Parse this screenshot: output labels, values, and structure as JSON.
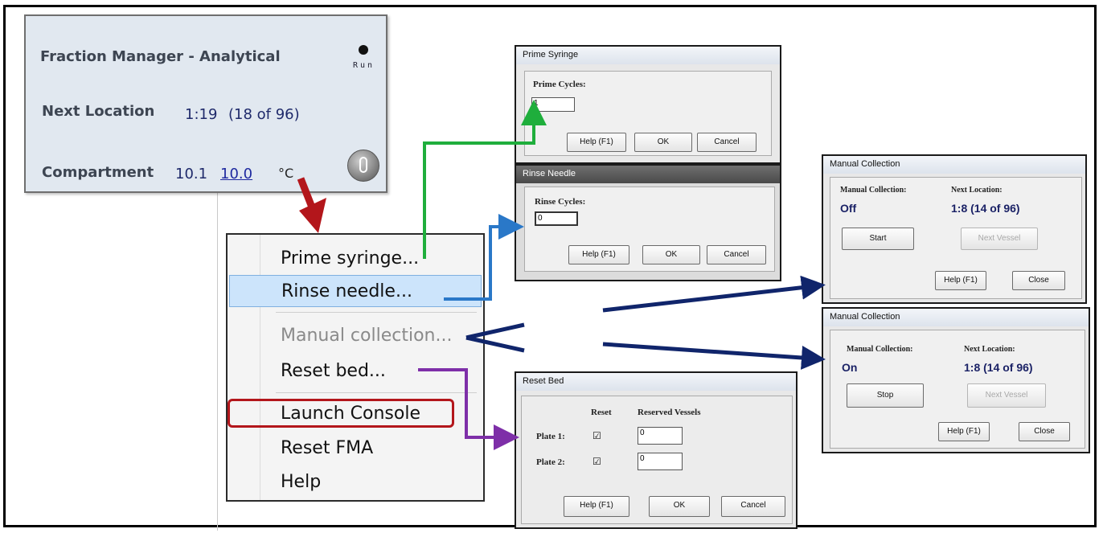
{
  "fraction_manager": {
    "title": "Fraction Manager - Analytical",
    "status": "Run",
    "next_location_label": "Next Location",
    "next_location_value": "1:19",
    "next_location_count": "(18 of 96)",
    "compartment_label": "Compartment",
    "compartment_actual": "10.1",
    "compartment_setpoint": "10.0",
    "compartment_unit": "°C"
  },
  "context_menu": {
    "items": [
      {
        "label": "Prime syringe..."
      },
      {
        "label": "Rinse needle..."
      },
      {
        "label": "Manual collection..."
      },
      {
        "label": "Reset bed..."
      },
      {
        "label": "Launch Console"
      },
      {
        "label": "Reset FMA"
      },
      {
        "label": "Help"
      }
    ]
  },
  "prime_syringe_dialog": {
    "title": "Prime Syringe",
    "field_label": "Prime Cycles:",
    "field_value": "1",
    "help": "Help (F1)",
    "ok": "OK",
    "cancel": "Cancel"
  },
  "rinse_needle_dialog": {
    "title": "Rinse Needle",
    "field_label": "Rinse Cycles:",
    "field_value": "0",
    "help": "Help (F1)",
    "ok": "OK",
    "cancel": "Cancel"
  },
  "reset_bed_dialog": {
    "title": "Reset Bed",
    "col_reset": "Reset",
    "col_reserved": "Reserved Vessels",
    "rows": [
      {
        "label": "Plate 1:",
        "checked": "☑",
        "value": "0"
      },
      {
        "label": "Plate 2:",
        "checked": "☑",
        "value": "0"
      }
    ],
    "help": "Help (F1)",
    "ok": "OK",
    "cancel": "Cancel"
  },
  "manual_collection_off": {
    "title": "Manual Collection",
    "mc_label": "Manual Collection:",
    "mc_value": "Off",
    "next_label": "Next Location:",
    "next_value": "1:8  (14 of 96)",
    "start": "Start",
    "next_vessel": "Next Vessel",
    "help": "Help (F1)",
    "close": "Close"
  },
  "manual_collection_on": {
    "title": "Manual Collection",
    "mc_label": "Manual Collection:",
    "mc_value": "On",
    "next_label": "Next Location:",
    "next_value": "1:8  (14 of 96)",
    "stop": "Stop",
    "next_vessel": "Next Vessel",
    "help": "Help (F1)",
    "close": "Close"
  },
  "colors": {
    "green_arrow": "#1fae3c",
    "blue_arrow": "#2a78c8",
    "navy_arrow": "#10256b",
    "purple_arrow": "#7e2fa8",
    "red_arrow": "#b3161b"
  }
}
